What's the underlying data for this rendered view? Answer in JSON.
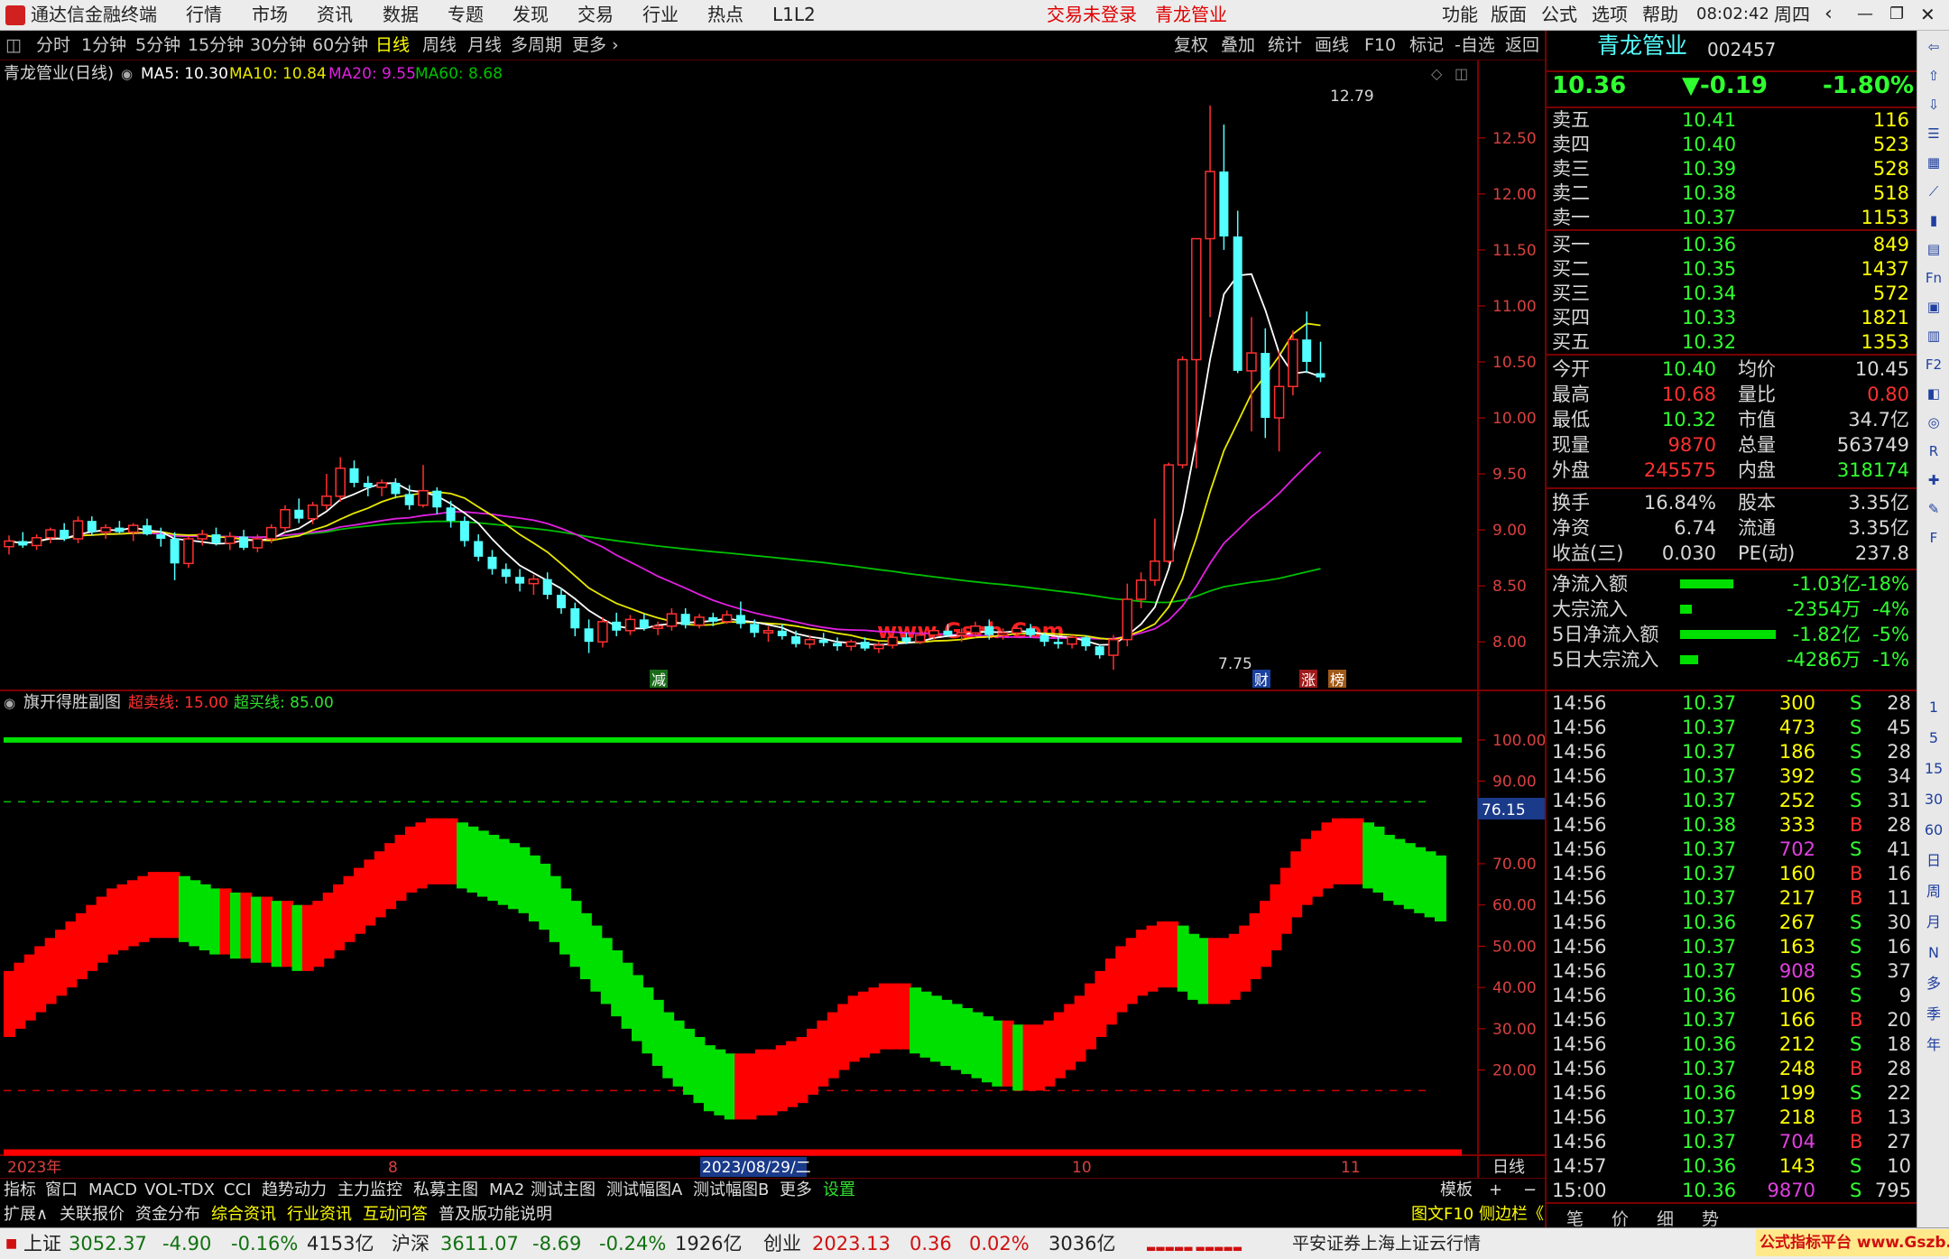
{
  "titlebar": {
    "app_title": "通达信金融终端",
    "menu": [
      "行情",
      "市场",
      "资讯",
      "数据",
      "专题",
      "发现",
      "交易",
      "行业",
      "热点",
      "L1L2"
    ],
    "login_status": "交易未登录",
    "stock_name": "青龙管业",
    "right_menu": [
      "功能",
      "版面",
      "公式",
      "选项",
      "帮助"
    ],
    "time": "08:02:42",
    "weekday": "周四"
  },
  "toolbar": {
    "periods": [
      "分时",
      "1分钟",
      "5分钟",
      "15分钟",
      "30分钟",
      "60分钟",
      "日线",
      "周线",
      "月线",
      "多周期",
      "更多"
    ],
    "active_period": "日线",
    "actions": [
      "复权",
      "叠加",
      "统计",
      "画线",
      "F10",
      "标记",
      "-自选",
      "返回"
    ]
  },
  "chart_header": {
    "title": "青龙管业(日线)",
    "ma5": "MA5: 10.30",
    "ma10": "MA10: 10.84",
    "ma20": "MA20: 9.55",
    "ma60": "MA60: 8.68"
  },
  "sub_header": {
    "title": "旗开得胜副图",
    "oversold": "超卖线: 15.00",
    "overbought": "超买线: 85.00",
    "current_value": "76.15"
  },
  "watermark": "www.Gszb.Com",
  "markers": {
    "jian": "减",
    "cai": "财",
    "zhang": "涨",
    "bang": "榜",
    "high_label": "12.79",
    "low_label": "7.75"
  },
  "colors": {
    "up": "#ff3030",
    "down": "#54ffff",
    "ma5": "#ffffff",
    "ma10": "#e8e800",
    "ma20": "#e020e0",
    "ma60": "#00c000",
    "osc_up": "#ff0000",
    "osc_down": "#00e000"
  },
  "chart_data": [
    {
      "type": "candlestick",
      "title": "青龙管业(日线)",
      "y_ticks": [
        12.5,
        12.0,
        11.5,
        11.0,
        10.5,
        10.0,
        9.5,
        9.0,
        8.5,
        8.0
      ],
      "ylim": [
        7.55,
        12.95
      ],
      "x_labels": [
        "2023年",
        "8",
        "2023/08/29/二",
        "10",
        "11"
      ],
      "candles": [
        [
          8.85,
          8.95,
          8.78,
          8.9
        ],
        [
          8.9,
          8.98,
          8.84,
          8.86
        ],
        [
          8.86,
          8.96,
          8.82,
          8.93
        ],
        [
          8.93,
          9.02,
          8.88,
          9.0
        ],
        [
          9.0,
          9.06,
          8.9,
          8.92
        ],
        [
          8.92,
          9.12,
          8.88,
          9.08
        ],
        [
          9.08,
          9.12,
          8.95,
          8.98
        ],
        [
          8.98,
          9.05,
          8.92,
          9.02
        ],
        [
          9.02,
          9.08,
          8.96,
          8.98
        ],
        [
          8.98,
          9.06,
          8.9,
          9.04
        ],
        [
          9.04,
          9.1,
          8.95,
          8.96
        ],
        [
          8.96,
          9.02,
          8.85,
          8.92
        ],
        [
          8.92,
          8.98,
          8.55,
          8.7
        ],
        [
          8.7,
          8.94,
          8.66,
          8.92
        ],
        [
          8.92,
          9.0,
          8.86,
          8.96
        ],
        [
          8.96,
          9.02,
          8.86,
          8.88
        ],
        [
          8.88,
          8.98,
          8.82,
          8.94
        ],
        [
          8.94,
          9.0,
          8.82,
          8.84
        ],
        [
          8.84,
          8.96,
          8.8,
          8.92
        ],
        [
          8.92,
          9.05,
          8.88,
          9.02
        ],
        [
          9.02,
          9.22,
          8.98,
          9.18
        ],
        [
          9.18,
          9.28,
          9.06,
          9.1
        ],
        [
          9.1,
          9.25,
          9.05,
          9.22
        ],
        [
          9.22,
          9.5,
          9.18,
          9.3
        ],
        [
          9.3,
          9.65,
          9.25,
          9.55
        ],
        [
          9.55,
          9.62,
          9.38,
          9.42
        ],
        [
          9.42,
          9.48,
          9.3,
          9.38
        ],
        [
          9.38,
          9.45,
          9.3,
          9.42
        ],
        [
          9.42,
          9.46,
          9.28,
          9.32
        ],
        [
          9.32,
          9.4,
          9.18,
          9.22
        ],
        [
          9.22,
          9.58,
          9.2,
          9.35
        ],
        [
          9.35,
          9.38,
          9.14,
          9.2
        ],
        [
          9.2,
          9.26,
          9.02,
          9.08
        ],
        [
          9.08,
          9.12,
          8.85,
          8.9
        ],
        [
          8.9,
          8.96,
          8.72,
          8.76
        ],
        [
          8.76,
          8.82,
          8.6,
          8.65
        ],
        [
          8.65,
          8.7,
          8.52,
          8.58
        ],
        [
          8.58,
          8.65,
          8.45,
          8.52
        ],
        [
          8.52,
          8.6,
          8.42,
          8.56
        ],
        [
          8.56,
          8.62,
          8.38,
          8.42
        ],
        [
          8.42,
          8.48,
          8.25,
          8.3
        ],
        [
          8.3,
          8.35,
          8.05,
          8.12
        ],
        [
          8.12,
          8.2,
          7.9,
          8.0
        ],
        [
          8.0,
          8.22,
          7.95,
          8.18
        ],
        [
          8.18,
          8.26,
          8.05,
          8.1
        ],
        [
          8.1,
          8.24,
          8.06,
          8.2
        ],
        [
          8.2,
          8.25,
          8.1,
          8.12
        ],
        [
          8.12,
          8.18,
          8.06,
          8.14
        ],
        [
          8.14,
          8.3,
          8.1,
          8.25
        ],
        [
          8.25,
          8.3,
          8.12,
          8.15
        ],
        [
          8.15,
          8.25,
          8.12,
          8.22
        ],
        [
          8.22,
          8.26,
          8.14,
          8.18
        ],
        [
          8.18,
          8.28,
          8.16,
          8.24
        ],
        [
          8.24,
          8.36,
          8.12,
          8.16
        ],
        [
          8.16,
          8.2,
          8.04,
          8.08
        ],
        [
          8.08,
          8.14,
          8.0,
          8.1
        ],
        [
          8.1,
          8.16,
          8.02,
          8.05
        ],
        [
          8.05,
          8.1,
          7.95,
          7.98
        ],
        [
          7.98,
          8.06,
          7.94,
          8.02
        ],
        [
          8.02,
          8.08,
          7.96,
          7.99
        ],
        [
          7.99,
          8.04,
          7.92,
          7.96
        ],
        [
          7.96,
          8.02,
          7.92,
          8.0
        ],
        [
          8.0,
          8.04,
          7.92,
          7.94
        ],
        [
          7.94,
          8.0,
          7.9,
          7.97
        ],
        [
          7.97,
          8.06,
          7.94,
          8.04
        ],
        [
          8.04,
          8.08,
          7.98,
          8.0
        ],
        [
          8.0,
          8.1,
          7.98,
          8.06
        ],
        [
          8.06,
          8.14,
          8.02,
          8.1
        ],
        [
          8.1,
          8.16,
          8.04,
          8.06
        ],
        [
          8.06,
          8.12,
          8.0,
          8.08
        ],
        [
          8.08,
          8.18,
          8.04,
          8.14
        ],
        [
          8.14,
          8.2,
          8.02,
          8.06
        ],
        [
          8.06,
          8.12,
          8.02,
          8.08
        ],
        [
          8.08,
          8.14,
          8.04,
          8.12
        ],
        [
          8.12,
          8.16,
          8.04,
          8.06
        ],
        [
          8.06,
          8.08,
          7.96,
          8.0
        ],
        [
          8.0,
          8.04,
          7.94,
          7.98
        ],
        [
          7.98,
          8.06,
          7.94,
          8.04
        ],
        [
          8.04,
          8.06,
          7.92,
          7.96
        ],
        [
          7.96,
          7.98,
          7.85,
          7.88
        ],
        [
          7.88,
          8.06,
          7.75,
          8.02
        ],
        [
          8.02,
          8.52,
          7.96,
          8.38
        ],
        [
          8.38,
          8.62,
          8.3,
          8.55
        ],
        [
          8.55,
          9.1,
          8.5,
          8.72
        ],
        [
          8.72,
          9.6,
          8.7,
          9.58
        ],
        [
          9.58,
          10.55,
          9.55,
          10.52
        ],
        [
          10.52,
          11.6,
          9.55,
          11.6
        ],
        [
          11.6,
          12.79,
          10.9,
          12.2
        ],
        [
          12.2,
          12.62,
          11.5,
          11.62
        ],
        [
          11.62,
          11.85,
          10.4,
          10.42
        ],
        [
          10.42,
          10.9,
          9.88,
          10.58
        ],
        [
          10.58,
          10.8,
          9.82,
          10.0
        ],
        [
          10.0,
          10.6,
          9.7,
          10.28
        ],
        [
          10.28,
          10.78,
          10.2,
          10.7
        ],
        [
          10.7,
          10.95,
          10.4,
          10.5
        ],
        [
          10.4,
          10.68,
          10.32,
          10.36
        ]
      ]
    },
    {
      "type": "area",
      "title": "旗开得胜副图",
      "y_ticks": [
        100.0,
        90.0,
        70.0,
        60.0,
        50.0,
        40.0,
        30.0,
        20.0
      ],
      "ylim": [
        0,
        105
      ],
      "oversold": 15.0,
      "overbought": 85.0,
      "values": [
        36,
        38,
        40,
        42,
        44,
        46,
        48,
        50,
        52,
        54,
        56,
        57,
        58,
        59,
        60,
        60,
        60,
        59,
        58,
        57,
        56,
        56,
        55,
        55,
        54,
        54,
        53,
        53,
        52,
        52,
        53,
        55,
        57,
        59,
        61,
        63,
        65,
        67,
        69,
        71,
        72,
        73,
        73,
        73,
        72,
        71,
        70,
        69,
        68,
        67,
        66,
        64,
        62,
        59,
        56,
        53,
        50,
        47,
        44,
        41,
        38,
        35,
        32,
        29,
        26,
        24,
        22,
        20,
        18,
        17,
        16,
        16,
        16,
        17,
        17,
        18,
        19,
        20,
        22,
        24,
        26,
        28,
        30,
        31,
        32,
        33,
        33,
        33,
        32,
        31,
        30,
        29,
        28,
        27,
        26,
        25,
        24,
        24,
        23,
        23,
        23,
        24,
        26,
        28,
        30,
        33,
        36,
        39,
        42,
        44,
        46,
        47,
        48,
        48,
        47,
        45,
        44,
        44,
        44,
        45,
        47,
        50,
        53,
        57,
        61,
        65,
        68,
        70,
        72,
        73,
        73,
        73,
        72,
        71,
        69,
        68,
        67,
        66,
        65,
        64
      ]
    }
  ],
  "quote": {
    "name": "青龙管业",
    "code": "002457",
    "price": "10.36",
    "change": "▼-0.19",
    "change_pct": "-1.80%",
    "asks": [
      [
        "卖五",
        "10.41",
        "116"
      ],
      [
        "卖四",
        "10.40",
        "523"
      ],
      [
        "卖三",
        "10.39",
        "528"
      ],
      [
        "卖二",
        "10.38",
        "518"
      ],
      [
        "卖一",
        "10.37",
        "1153"
      ]
    ],
    "bids": [
      [
        "买一",
        "10.36",
        "849"
      ],
      [
        "买二",
        "10.35",
        "1437"
      ],
      [
        "买三",
        "10.34",
        "572"
      ],
      [
        "买四",
        "10.33",
        "1821"
      ],
      [
        "买五",
        "10.32",
        "1353"
      ]
    ],
    "stats": [
      [
        "今开",
        "10.40",
        "均价",
        "10.45"
      ],
      [
        "最高",
        "10.68",
        "量比",
        "0.80"
      ],
      [
        "最低",
        "10.32",
        "市值",
        "34.7亿"
      ],
      [
        "现量",
        "9870",
        "总量",
        "563749"
      ],
      [
        "外盘",
        "245575",
        "内盘",
        "318174"
      ]
    ],
    "stats2": [
      [
        "换手",
        "16.84%",
        "股本",
        "3.35亿"
      ],
      [
        "净资",
        "6.74",
        "流通",
        "3.35亿"
      ],
      [
        "收益(三)",
        "0.030",
        "PE(动)",
        "237.8"
      ]
    ],
    "flows": [
      [
        "净流入额",
        "-1.03亿",
        "-18%",
        0.18
      ],
      [
        "大宗流入",
        "-2354万",
        "-4%",
        0.04
      ],
      [
        "5日净流入额",
        "-1.82亿",
        "-5%",
        0.32
      ],
      [
        "5日大宗流入",
        "-4286万",
        "-1%",
        0.06
      ]
    ],
    "ticks": [
      [
        "14:56",
        "10.37",
        "300",
        "S",
        "28"
      ],
      [
        "14:56",
        "10.37",
        "473",
        "S",
        "45"
      ],
      [
        "14:56",
        "10.37",
        "186",
        "S",
        "28"
      ],
      [
        "14:56",
        "10.37",
        "392",
        "S",
        "34"
      ],
      [
        "14:56",
        "10.37",
        "252",
        "S",
        "31"
      ],
      [
        "14:56",
        "10.38",
        "333",
        "B",
        "28"
      ],
      [
        "14:56",
        "10.37",
        "702",
        "S",
        "41"
      ],
      [
        "14:56",
        "10.37",
        "160",
        "B",
        "16"
      ],
      [
        "14:56",
        "10.37",
        "217",
        "B",
        "11"
      ],
      [
        "14:56",
        "10.36",
        "267",
        "S",
        "30"
      ],
      [
        "14:56",
        "10.37",
        "163",
        "S",
        "16"
      ],
      [
        "14:56",
        "10.37",
        "908",
        "S",
        "37"
      ],
      [
        "14:56",
        "10.36",
        "106",
        "S",
        "9"
      ],
      [
        "14:56",
        "10.37",
        "166",
        "B",
        "20"
      ],
      [
        "14:56",
        "10.36",
        "212",
        "S",
        "18"
      ],
      [
        "14:56",
        "10.37",
        "248",
        "B",
        "28"
      ],
      [
        "14:56",
        "10.36",
        "199",
        "S",
        "22"
      ],
      [
        "14:56",
        "10.37",
        "218",
        "B",
        "13"
      ],
      [
        "14:56",
        "10.37",
        "704",
        "B",
        "27"
      ],
      [
        "14:57",
        "10.36",
        "143",
        "S",
        "10"
      ],
      [
        "15:00",
        "10.36",
        "9870",
        "S",
        "795"
      ]
    ],
    "bottom_tabs": [
      "笔",
      "价",
      "细",
      "势"
    ]
  },
  "sidebar_labels": [
    "1",
    "5",
    "15",
    "30",
    "60",
    "日",
    "周",
    "月",
    "N",
    "多",
    "季",
    "年"
  ],
  "tabs1": [
    "指标",
    "窗口",
    "MACD",
    "VOL-TDX",
    "CCI",
    "趋势动力",
    "主力监控",
    "私募主图",
    "MA2",
    "测试主图",
    "测试幅图A",
    "测试幅图B",
    "更多",
    "设置"
  ],
  "tabs1_right": [
    "模板",
    "+",
    "−"
  ],
  "tabs2": [
    "扩展∧",
    "关联报价",
    "资金分布",
    "综合资讯",
    "行业资讯",
    "互动问答",
    "普及版功能说明"
  ],
  "tabs2_right": "图文F10 侧边栏《",
  "period_label": "日线",
  "status": {
    "sh_name": "上证",
    "sh_val": "3052.37",
    "sh_chg": "-4.90",
    "sh_pct": "-0.16%",
    "sh_amt": "4153亿",
    "hs_name": "沪深",
    "hs_val": "3611.07",
    "hs_chg": "-8.69",
    "hs_pct": "-0.24%",
    "hs_amt": "1926亿",
    "cy_name": "创业",
    "cy_val": "2023.13",
    "cy_chg": "0.36",
    "cy_pct": "0.02%",
    "cy_amt": "3036亿",
    "broker": "平安证券上海上证云行情",
    "brand": "公式指标平台 www.Gszb.Com"
  }
}
